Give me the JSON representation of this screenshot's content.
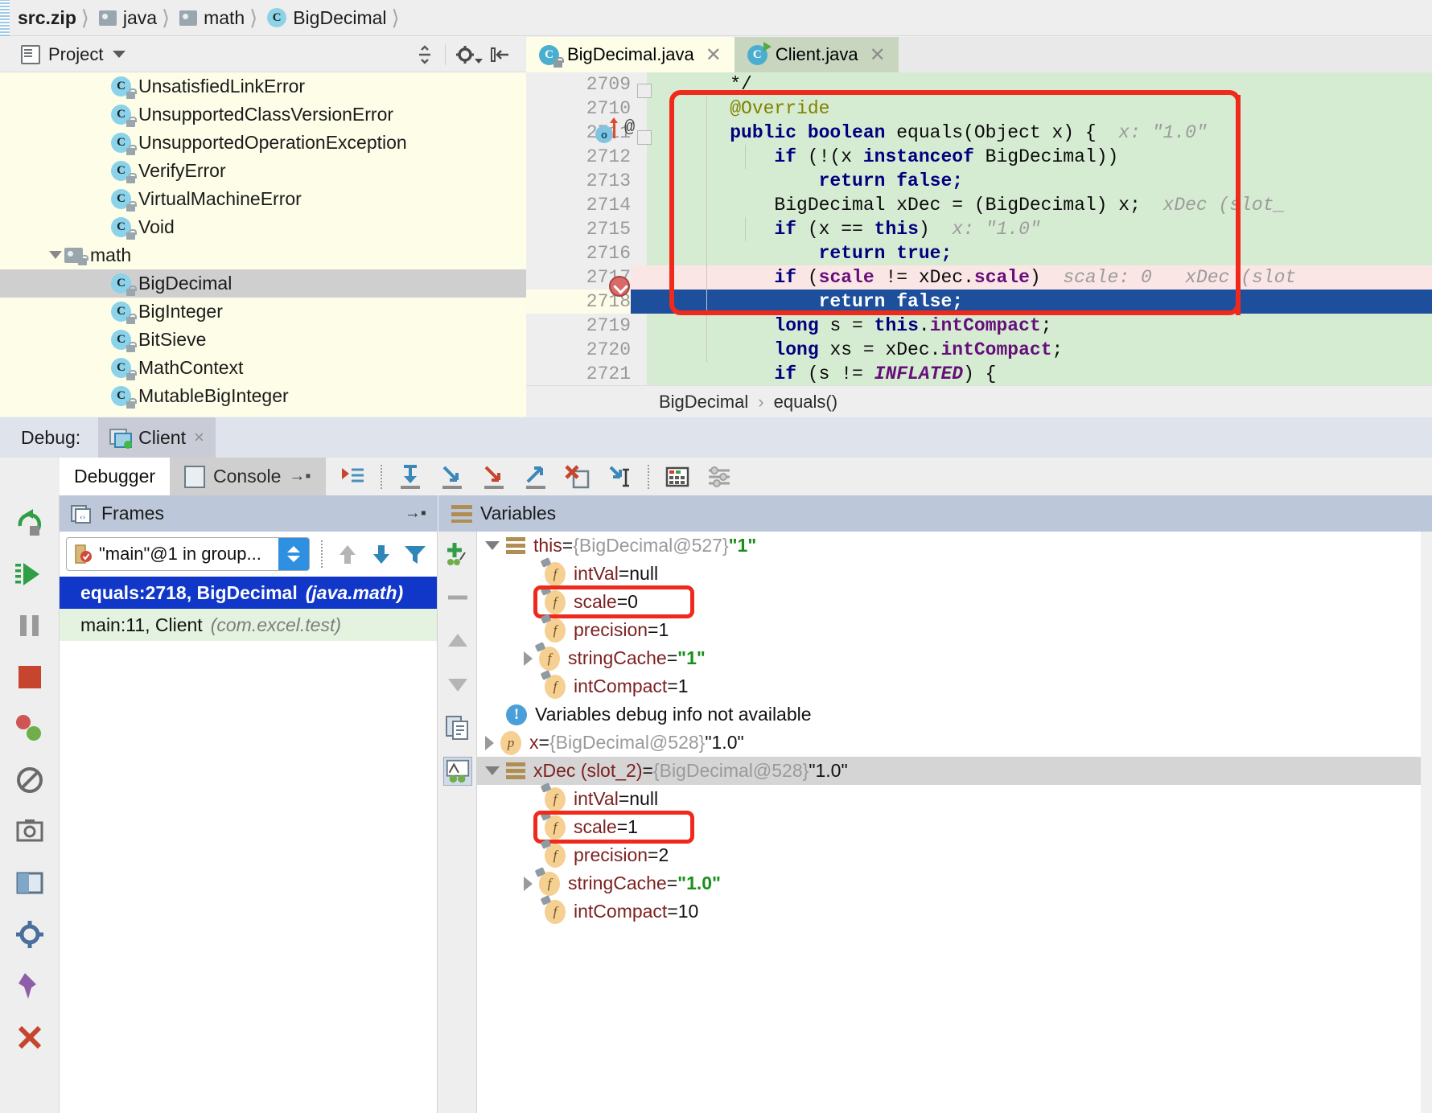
{
  "breadcrumb": {
    "items": [
      {
        "label": "src.zip",
        "icon": "archive-icon"
      },
      {
        "label": "java",
        "icon": "folder-icon"
      },
      {
        "label": "math",
        "icon": "folder-icon"
      },
      {
        "label": "BigDecimal",
        "icon": "class-icon"
      }
    ]
  },
  "project_panel": {
    "title": "Project",
    "toolbar": {
      "collapse_all": "collapse-all-icon",
      "settings": "gear-icon",
      "hide": "hide-panel-icon"
    },
    "tree": [
      {
        "label": "UnsatisfiedLinkError",
        "type": "class",
        "indent": 2,
        "selected": false
      },
      {
        "label": "UnsupportedClassVersionError",
        "type": "class",
        "indent": 2,
        "selected": false
      },
      {
        "label": "UnsupportedOperationException",
        "type": "class",
        "indent": 2,
        "selected": false
      },
      {
        "label": "VerifyError",
        "type": "class",
        "indent": 2,
        "selected": false
      },
      {
        "label": "VirtualMachineError",
        "type": "class",
        "indent": 2,
        "selected": false
      },
      {
        "label": "Void",
        "type": "class",
        "indent": 2,
        "selected": false
      },
      {
        "label": "math",
        "type": "folder",
        "indent": 1,
        "selected": false,
        "expanded": true
      },
      {
        "label": "BigDecimal",
        "type": "class",
        "indent": 2,
        "selected": true
      },
      {
        "label": "BigInteger",
        "type": "class",
        "indent": 2,
        "selected": false
      },
      {
        "label": "BitSieve",
        "type": "class",
        "indent": 2,
        "selected": false
      },
      {
        "label": "MathContext",
        "type": "class",
        "indent": 2,
        "selected": false
      },
      {
        "label": "MutableBigInteger",
        "type": "class",
        "indent": 2,
        "selected": false
      }
    ]
  },
  "editor": {
    "tabs": [
      {
        "label": "BigDecimal.java",
        "active": true,
        "icon": "class-locked-icon"
      },
      {
        "label": "Client.java",
        "active": false,
        "icon": "class-run-icon"
      }
    ],
    "breadcrumb": {
      "class": "BigDecimal",
      "separator": "›",
      "method": "equals()"
    },
    "lines": [
      {
        "num": "2709",
        "state": "normal",
        "tokens": [
          {
            "t": "plain",
            "s": "    */"
          }
        ]
      },
      {
        "num": "2710",
        "state": "normal",
        "tokens": [
          {
            "t": "anno",
            "s": "    @Override"
          }
        ]
      },
      {
        "num": "2711",
        "state": "normal",
        "marker": "override-marker",
        "tokens": [
          {
            "t": "kw",
            "s": "    public boolean "
          },
          {
            "t": "plain",
            "s": "equals(Object x) {"
          }
        ],
        "hint": "x: \"1.0\""
      },
      {
        "num": "2712",
        "state": "normal",
        "tokens": [
          {
            "t": "kw",
            "s": "        if "
          },
          {
            "t": "plain",
            "s": "(!(x "
          },
          {
            "t": "kw",
            "s": "instanceof "
          },
          {
            "t": "plain",
            "s": "BigDecimal))"
          }
        ]
      },
      {
        "num": "2713",
        "state": "normal",
        "tokens": [
          {
            "t": "kw",
            "s": "            return false;"
          }
        ]
      },
      {
        "num": "2714",
        "state": "normal",
        "tokens": [
          {
            "t": "plain",
            "s": "        BigDecimal xDec = (BigDecimal) x;"
          }
        ],
        "hint": "xDec (slot_"
      },
      {
        "num": "2715",
        "state": "normal",
        "tokens": [
          {
            "t": "kw",
            "s": "        if "
          },
          {
            "t": "plain",
            "s": "(x == "
          },
          {
            "t": "kw",
            "s": "this"
          },
          {
            "t": "plain",
            "s": ")"
          }
        ],
        "hint": "x: \"1.0\""
      },
      {
        "num": "2716",
        "state": "normal",
        "tokens": [
          {
            "t": "kw",
            "s": "            return true;"
          }
        ]
      },
      {
        "num": "2717",
        "state": "breakpoint",
        "marker": "breakpoint",
        "tokens": [
          {
            "t": "kw",
            "s": "        if "
          },
          {
            "t": "plain",
            "s": "("
          },
          {
            "t": "fld",
            "s": "scale"
          },
          {
            "t": "plain",
            "s": " != xDec."
          },
          {
            "t": "fld",
            "s": "scale"
          },
          {
            "t": "plain",
            "s": ")"
          }
        ],
        "hint": "scale: 0   xDec (slot"
      },
      {
        "num": "2718",
        "state": "executing",
        "tokens": [
          {
            "t": "kw",
            "s": "            return false;"
          }
        ]
      },
      {
        "num": "2719",
        "state": "normal",
        "tokens": [
          {
            "t": "kw",
            "s": "        long "
          },
          {
            "t": "plain",
            "s": "s = "
          },
          {
            "t": "kw",
            "s": "this"
          },
          {
            "t": "plain",
            "s": "."
          },
          {
            "t": "fld",
            "s": "intCompact"
          },
          {
            "t": "plain",
            "s": ";"
          }
        ]
      },
      {
        "num": "2720",
        "state": "normal",
        "tokens": [
          {
            "t": "kw",
            "s": "        long "
          },
          {
            "t": "plain",
            "s": "xs = xDec."
          },
          {
            "t": "fld",
            "s": "intCompact"
          },
          {
            "t": "plain",
            "s": ";"
          }
        ]
      },
      {
        "num": "2721",
        "state": "normal",
        "tokens": [
          {
            "t": "kw",
            "s": "        if "
          },
          {
            "t": "plain",
            "s": "(s != "
          },
          {
            "t": "stat",
            "s": "INFLATED"
          },
          {
            "t": "plain",
            "s": ") {"
          }
        ]
      }
    ]
  },
  "debug": {
    "label": "Debug:",
    "session_tab": {
      "label": "Client",
      "close": "×"
    },
    "tabs": [
      {
        "label": "Debugger",
        "selected": true
      },
      {
        "label": "Console",
        "selected": false
      }
    ],
    "toolbar_icons": [
      "show-execution-point-icon",
      "step-over-icon",
      "step-into-icon",
      "force-step-into-icon",
      "step-out-icon",
      "drop-frame-icon",
      "run-to-cursor-icon",
      "evaluate-expression-icon",
      "settings-icon"
    ],
    "rail_icons": [
      "rerun-icon",
      "resume-program-icon",
      "pause-program-icon",
      "stop-icon",
      "view-breakpoints-icon",
      "mute-breakpoints-icon",
      "get-thread-dump-icon",
      "restore-layout-icon",
      "settings-gear-icon",
      "pin-tab-icon",
      "close-icon"
    ],
    "frames": {
      "title": "Frames",
      "thread": "\"main\"@1 in group...",
      "nav_icons": [
        "up-arrow-icon",
        "down-arrow-icon",
        "filter-icon"
      ],
      "stack": [
        {
          "method": "equals:2718, BigDecimal",
          "package": "(java.math)",
          "selected": true
        },
        {
          "method": "main:11, Client",
          "package": "(com.excel.test)",
          "selected": false
        }
      ]
    },
    "variables": {
      "title": "Variables",
      "rail_icons": [
        "add-watch-icon",
        "remove-icon",
        "move-up-icon",
        "move-down-icon",
        "copy-value-icon",
        "inspect-icon"
      ],
      "rows": [
        {
          "indent": 0,
          "toggle": "down",
          "icon": "object-icon",
          "name": "this",
          "eq": " = ",
          "ref": "{BigDecimal@527}",
          "str": "\"1\"",
          "highlight": false,
          "annotated": false
        },
        {
          "indent": 1,
          "toggle": "none",
          "icon": "field-icon",
          "name": "intVal",
          "eq": " = ",
          "value": "null",
          "highlight": false,
          "annotated": false
        },
        {
          "indent": 1,
          "toggle": "none",
          "icon": "field-icon",
          "name": "scale",
          "eq": " = ",
          "value": "0",
          "highlight": false,
          "annotated": true
        },
        {
          "indent": 1,
          "toggle": "none",
          "icon": "field-icon",
          "name": "precision",
          "eq": " = ",
          "value": "1",
          "highlight": false,
          "annotated": false
        },
        {
          "indent": 1,
          "toggle": "right",
          "icon": "field-icon",
          "name": "stringCache",
          "eq": " = ",
          "str": "\"1\"",
          "highlight": false,
          "annotated": false
        },
        {
          "indent": 1,
          "toggle": "none",
          "icon": "field-icon",
          "name": "intCompact",
          "eq": " = ",
          "value": "1",
          "highlight": false,
          "annotated": false
        },
        {
          "indent": 0,
          "toggle": "none",
          "icon": "info-icon",
          "message": "Variables debug info not available",
          "highlight": false,
          "annotated": false
        },
        {
          "indent": 0,
          "toggle": "right",
          "icon": "param-icon",
          "name": "x",
          "eq": " = ",
          "ref": "{BigDecimal@528}",
          "str": "\"1.0\"",
          "highlight": false,
          "annotated": false,
          "plainstr": true
        },
        {
          "indent": 0,
          "toggle": "down",
          "icon": "object-icon",
          "name": "xDec (slot_2)",
          "eq": " = ",
          "ref": "{BigDecimal@528}",
          "str": "\"1.0\"",
          "highlight": true,
          "annotated": false,
          "plainstr": true
        },
        {
          "indent": 1,
          "toggle": "none",
          "icon": "field-icon",
          "name": "intVal",
          "eq": " = ",
          "value": "null",
          "highlight": false,
          "annotated": false
        },
        {
          "indent": 1,
          "toggle": "none",
          "icon": "field-icon",
          "name": "scale",
          "eq": " = ",
          "value": "1",
          "highlight": false,
          "annotated": true
        },
        {
          "indent": 1,
          "toggle": "none",
          "icon": "field-icon",
          "name": "precision",
          "eq": " = ",
          "value": "2",
          "highlight": false,
          "annotated": false
        },
        {
          "indent": 1,
          "toggle": "right",
          "icon": "field-icon",
          "name": "stringCache",
          "eq": " = ",
          "str": "\"1.0\"",
          "highlight": false,
          "annotated": false
        },
        {
          "indent": 1,
          "toggle": "none",
          "icon": "field-icon",
          "name": "intCompact",
          "eq": " = ",
          "value": "10",
          "highlight": false,
          "annotated": false
        }
      ]
    }
  },
  "colors": {
    "annotation_red": "#ef2a1c",
    "exec_line": "#1e4f9c",
    "breakpoint_line": "#fbe6e6",
    "debug_highlight": "#d6ecd2",
    "tree_bg": "#fdfde8"
  }
}
